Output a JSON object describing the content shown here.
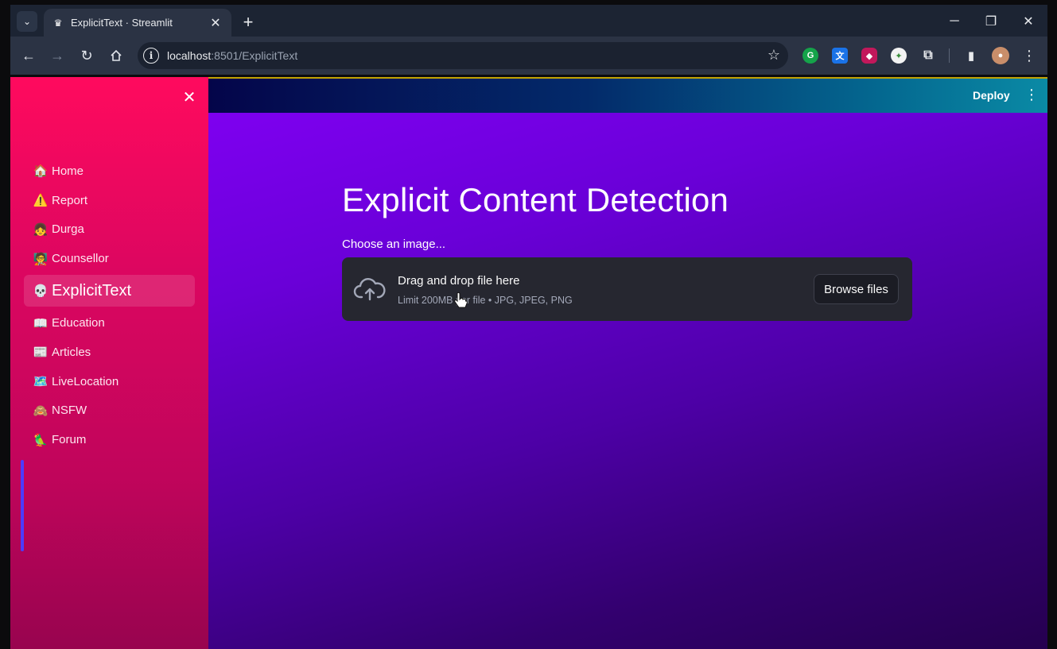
{
  "browser": {
    "tab_title": "ExplicitText · Streamlit",
    "url_host": "localhost",
    "url_path": ":8501/ExplicitText"
  },
  "header": {
    "deploy_label": "Deploy"
  },
  "sidebar": {
    "items": [
      {
        "emoji": "🏠",
        "label": "Home",
        "active": false
      },
      {
        "emoji": "⚠️",
        "label": "Report",
        "active": false
      },
      {
        "emoji": "👧",
        "label": "Durga",
        "active": false
      },
      {
        "emoji": "🧑‍🏫",
        "label": "Counsellor",
        "active": false
      },
      {
        "emoji": "💀",
        "label": "ExplicitText",
        "active": true
      },
      {
        "emoji": "📖",
        "label": "Education",
        "active": false
      },
      {
        "emoji": "📰",
        "label": "Articles",
        "active": false
      },
      {
        "emoji": "🗺️",
        "label": "LiveLocation",
        "active": false
      },
      {
        "emoji": "🙈",
        "label": "NSFW",
        "active": false
      },
      {
        "emoji": "🦜",
        "label": "Forum",
        "active": false
      }
    ]
  },
  "main": {
    "title": "Explicit Content Detection",
    "uploader_label": "Choose an image...",
    "dropzone_title": "Drag and drop file here",
    "dropzone_hint": "Limit 200MB per file • JPG, JPEG, PNG",
    "browse_label": "Browse files"
  },
  "colors": {
    "sidebar_top": "#ff0a5e",
    "main_top": "#7e00f0",
    "dropzone": "#262730"
  },
  "icons": {
    "favicon": "crown-icon",
    "upload": "cloud-upload-icon"
  }
}
